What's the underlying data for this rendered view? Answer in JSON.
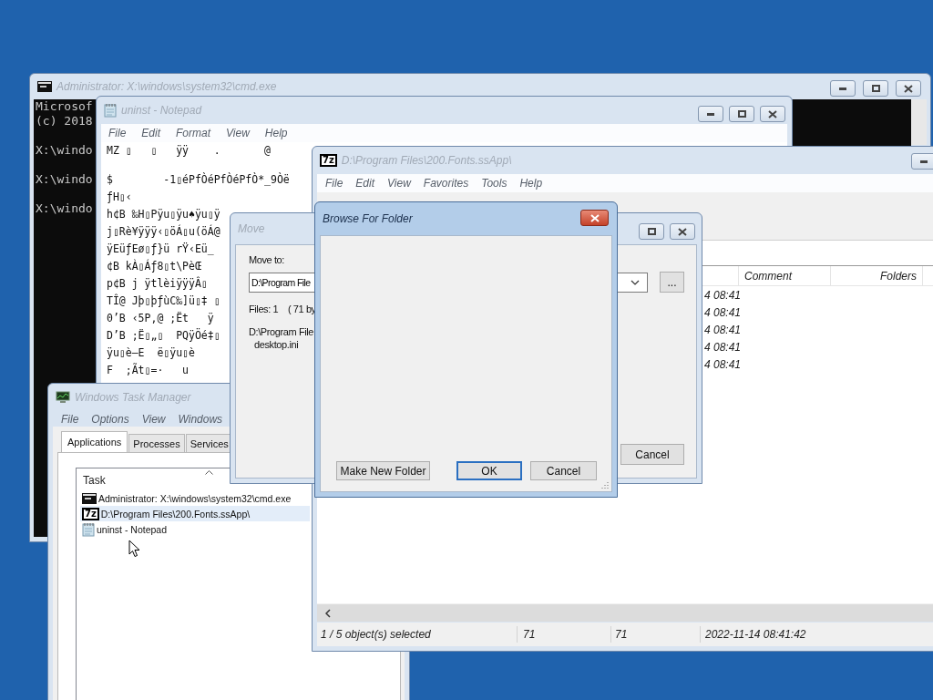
{
  "console_window": {
    "title": "Administrator: X:\\windows\\system32\\cmd.exe",
    "active": false,
    "paragraphs": [
      [
        "Microsof",
        "(c) 2018"
      ],
      [
        "X:\\windo"
      ],
      [
        "X:\\windo"
      ],
      [
        "X:\\windo"
      ]
    ]
  },
  "notepad_window": {
    "title": "uninst - Notepad",
    "active": false,
    "menu": [
      "File",
      "Edit",
      "Format",
      "View",
      "Help"
    ],
    "paragraphs": [
      [
        "MZ ▯   ▯   ÿÿ    .       @"
      ],
      [
        "$        -1▯éPfÒéPfÒéPfÒ*_9Òë",
        "ƒH▯‹",
        "h¢B ‰H▯Pÿu▯ÿu♠ÿu▯ÿ",
        "j▯Rè¥ÿÿÿ‹▯öÁ▯u(öÁ@",
        "ÿEüƒEø▯ƒ}ü rŸ‹Eü_",
        "¢B kÀ▯Áƒ8▯t\\PèŒ",
        "p¢B j ÿtlèiÿÿÿÂ▯",
        "TÎ@ Jþ▯þƒùC‰]ü▯‡ ▯",
        "0’B ‹5P,@ ;Ët   ÿ",
        "D’B ;Ë▯„▯  PQÿÖé‡▯",
        "ÿu▯è—E  ë▯ÿu▯è",
        "F  ;Ãt▯=·   u"
      ]
    ]
  },
  "task_manager": {
    "title": "Windows Task Manager",
    "active": false,
    "menu": [
      "File",
      "Options",
      "View",
      "Windows"
    ],
    "tabs": [
      {
        "label": "Applications",
        "selected": true
      },
      {
        "label": "Processes",
        "selected": false
      },
      {
        "label": "Services",
        "selected": false
      }
    ],
    "column": "Task",
    "rows": [
      {
        "kind": "console",
        "label": "Administrator: X:\\windows\\system32\\cmd.exe",
        "selected": false
      },
      {
        "kind": "archive",
        "icon_text": "7z",
        "label": "D:\\Program Files\\200.Fonts.ssApp\\",
        "selected": true
      },
      {
        "kind": "notepad",
        "label": "uninst - Notepad",
        "selected": false
      }
    ]
  },
  "archive_window": {
    "title": "D:\\Program Files\\200.Fonts.ssApp\\",
    "icon_text": "7z",
    "active": false,
    "menu": [
      "File",
      "Edit",
      "View",
      "Favorites",
      "Tools",
      "Help"
    ],
    "columns": [
      "Comment",
      "Folders"
    ],
    "date_cells": [
      "4 08:41",
      "4 08:41",
      "4 08:41",
      "4 08:41",
      "4 08:41"
    ],
    "status": [
      "1 / 5 object(s) selected",
      "71",
      "71",
      "2022-11-14 08:41:42"
    ]
  },
  "move_dialog": {
    "title": "Move",
    "active": false,
    "target_label": "Move to:",
    "target_value": "D:\\Program File",
    "browse_button": "...",
    "files_info": "Files: 1    ( 71 by",
    "source_lines": [
      "D:\\Program File",
      "desktop.ini"
    ],
    "cancel_button": "Cancel"
  },
  "browse_dialog": {
    "title": "Browse For Folder",
    "active": true,
    "buttons": [
      {
        "label": "Make New Folder",
        "default": false
      },
      {
        "label": "OK",
        "default": true
      },
      {
        "label": "Cancel",
        "default": false
      }
    ]
  }
}
